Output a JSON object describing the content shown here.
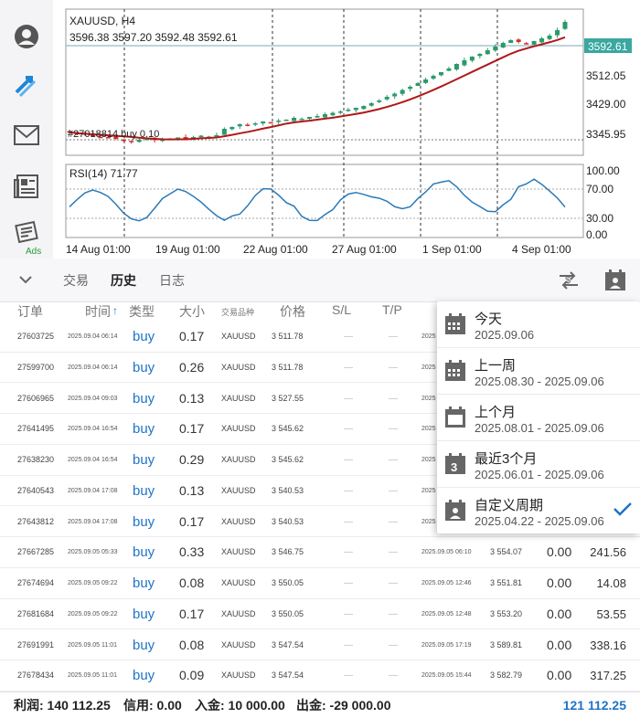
{
  "chart": {
    "symbol_tf": "XAUUSD, H4",
    "ohlc": "3596.38 3597.20 3592.48 3592.61",
    "current_price": "3592.61",
    "price_ticks": [
      "3512.05",
      "3429.00",
      "3345.95"
    ],
    "order_line_label": "#27018814 buy  0.10",
    "rsi_label": "RSI(14) 71.77",
    "rsi_ticks": [
      "100.00",
      "70.00",
      "30.00",
      "0.00"
    ],
    "time_labels": [
      "14 Aug 01:00",
      "19 Aug 01:00",
      "22 Aug 01:00",
      "27 Aug 01:00",
      "1 Sep 01:00",
      "4 Sep 01:00"
    ],
    "candle_color_up": "#2a9a6a",
    "candle_color_down": "#d03030",
    "ma_color": "#b01818",
    "rsi_color": "#2a7ab8",
    "closes": [
      3350,
      3347,
      3345,
      3342,
      3340,
      3338,
      3336,
      3333,
      3331,
      3334,
      3336,
      3333,
      3335,
      3337,
      3339,
      3338,
      3340,
      3343,
      3341,
      3344,
      3358,
      3362,
      3368,
      3366,
      3370,
      3374,
      3372,
      3376,
      3378,
      3382,
      3380,
      3384,
      3386,
      3390,
      3393,
      3396,
      3400,
      3404,
      3408,
      3414,
      3420,
      3428,
      3435,
      3443,
      3450,
      3458,
      3466,
      3474,
      3482,
      3490,
      3500,
      3508,
      3516,
      3522,
      3530,
      3538,
      3546,
      3552,
      3548,
      3545,
      3550,
      3556,
      3562,
      3574,
      3592
    ]
  },
  "toolbar": {
    "tabs": [
      "交易",
      "历史",
      "日志"
    ],
    "active_tab": "历史"
  },
  "table": {
    "headers": {
      "order": "订单",
      "time": "时间",
      "type": "类型",
      "size": "大小",
      "symbol": "交易品种",
      "price": "价格",
      "sl": "S/L",
      "tp": "T/P"
    },
    "rows": [
      {
        "order": "27603725",
        "time": "2025.09.04 06:14",
        "type": "buy",
        "size": "0.17",
        "symbol": "XAUUSD",
        "price": "3 511.78",
        "sl": "—",
        "tp": "—",
        "close_time": "2025",
        "close_price": "",
        "commission": "",
        "profit": ""
      },
      {
        "order": "27599700",
        "time": "2025.09.04 06:14",
        "type": "buy",
        "size": "0.26",
        "symbol": "XAUUSD",
        "price": "3 511.78",
        "sl": "—",
        "tp": "—",
        "close_time": "2025",
        "close_price": "",
        "commission": "",
        "profit": ""
      },
      {
        "order": "27606965",
        "time": "2025.09.04 09:03",
        "type": "buy",
        "size": "0.13",
        "symbol": "XAUUSD",
        "price": "3 527.55",
        "sl": "—",
        "tp": "—",
        "close_time": "2025",
        "close_price": "",
        "commission": "",
        "profit": ""
      },
      {
        "order": "27641495",
        "time": "2025.09.04 16:54",
        "type": "buy",
        "size": "0.17",
        "symbol": "XAUUSD",
        "price": "3 545.62",
        "sl": "—",
        "tp": "—",
        "close_time": "2025",
        "close_price": "",
        "commission": "",
        "profit": ""
      },
      {
        "order": "27638230",
        "time": "2025.09.04 16:54",
        "type": "buy",
        "size": "0.29",
        "symbol": "XAUUSD",
        "price": "3 545.62",
        "sl": "—",
        "tp": "—",
        "close_time": "2025",
        "close_price": "",
        "commission": "",
        "profit": ""
      },
      {
        "order": "27640543",
        "time": "2025.09.04 17:08",
        "type": "buy",
        "size": "0.13",
        "symbol": "XAUUSD",
        "price": "3 540.53",
        "sl": "—",
        "tp": "—",
        "close_time": "2025",
        "close_price": "",
        "commission": "",
        "profit": ""
      },
      {
        "order": "27643812",
        "time": "2025.09.04 17:08",
        "type": "buy",
        "size": "0.17",
        "symbol": "XAUUSD",
        "price": "3 540.53",
        "sl": "—",
        "tp": "—",
        "close_time": "2025",
        "close_price": "",
        "commission": "",
        "profit": ""
      },
      {
        "order": "27667285",
        "time": "2025.09.05 05:33",
        "type": "buy",
        "size": "0.33",
        "symbol": "XAUUSD",
        "price": "3 546.75",
        "sl": "—",
        "tp": "—",
        "close_time": "2025.09.05 06:10",
        "close_price": "3 554.07",
        "commission": "0.00",
        "profit": "241.56"
      },
      {
        "order": "27674694",
        "time": "2025.09.05 09:22",
        "type": "buy",
        "size": "0.08",
        "symbol": "XAUUSD",
        "price": "3 550.05",
        "sl": "—",
        "tp": "—",
        "close_time": "2025.09.05 12:46",
        "close_price": "3 551.81",
        "commission": "0.00",
        "profit": "14.08"
      },
      {
        "order": "27681684",
        "time": "2025.09.05 09:22",
        "type": "buy",
        "size": "0.17",
        "symbol": "XAUUSD",
        "price": "3 550.05",
        "sl": "—",
        "tp": "—",
        "close_time": "2025.09.05 12:48",
        "close_price": "3 553.20",
        "commission": "0.00",
        "profit": "53.55"
      },
      {
        "order": "27691991",
        "time": "2025.09.05 11:01",
        "type": "buy",
        "size": "0.08",
        "symbol": "XAUUSD",
        "price": "3 547.54",
        "sl": "—",
        "tp": "—",
        "close_time": "2025.09.05 17:19",
        "close_price": "3 589.81",
        "commission": "0.00",
        "profit": "338.16"
      },
      {
        "order": "27678434",
        "time": "2025.09.05 11:01",
        "type": "buy",
        "size": "0.09",
        "symbol": "XAUUSD",
        "price": "3 547.54",
        "sl": "—",
        "tp": "—",
        "close_time": "2025.09.05 15:44",
        "close_price": "3 582.79",
        "commission": "0.00",
        "profit": "317.25"
      }
    ]
  },
  "footer": {
    "profit": "利润: 140 112.25",
    "credit": "信用: 0.00",
    "deposit": "入金: 10 000.00",
    "withdrawal": "出金: -29 000.00",
    "total": "121 112.25"
  },
  "popup": {
    "items": [
      {
        "title": "今天",
        "range": "2025.09.06",
        "icon": "calendar-icon"
      },
      {
        "title": "上一周",
        "range": "2025.08.30 - 2025.09.06",
        "icon": "calendar-icon"
      },
      {
        "title": "上个月",
        "range": "2025.08.01 - 2025.09.06",
        "icon": "calendar-icon"
      },
      {
        "title": "最近3个月",
        "range": "2025.06.01 - 2025.09.06",
        "icon": "calendar-3-icon",
        "icon_text": "3"
      },
      {
        "title": "自定义周期",
        "range": "2025.04.22 - 2025.09.06",
        "icon": "custom-calendar-icon",
        "selected": true
      }
    ]
  },
  "sidebar": {
    "ads_label": "Ads",
    "icons": [
      "account-icon",
      "trade-arrows-icon",
      "mail-icon",
      "news-icon",
      "ads-icon"
    ]
  }
}
